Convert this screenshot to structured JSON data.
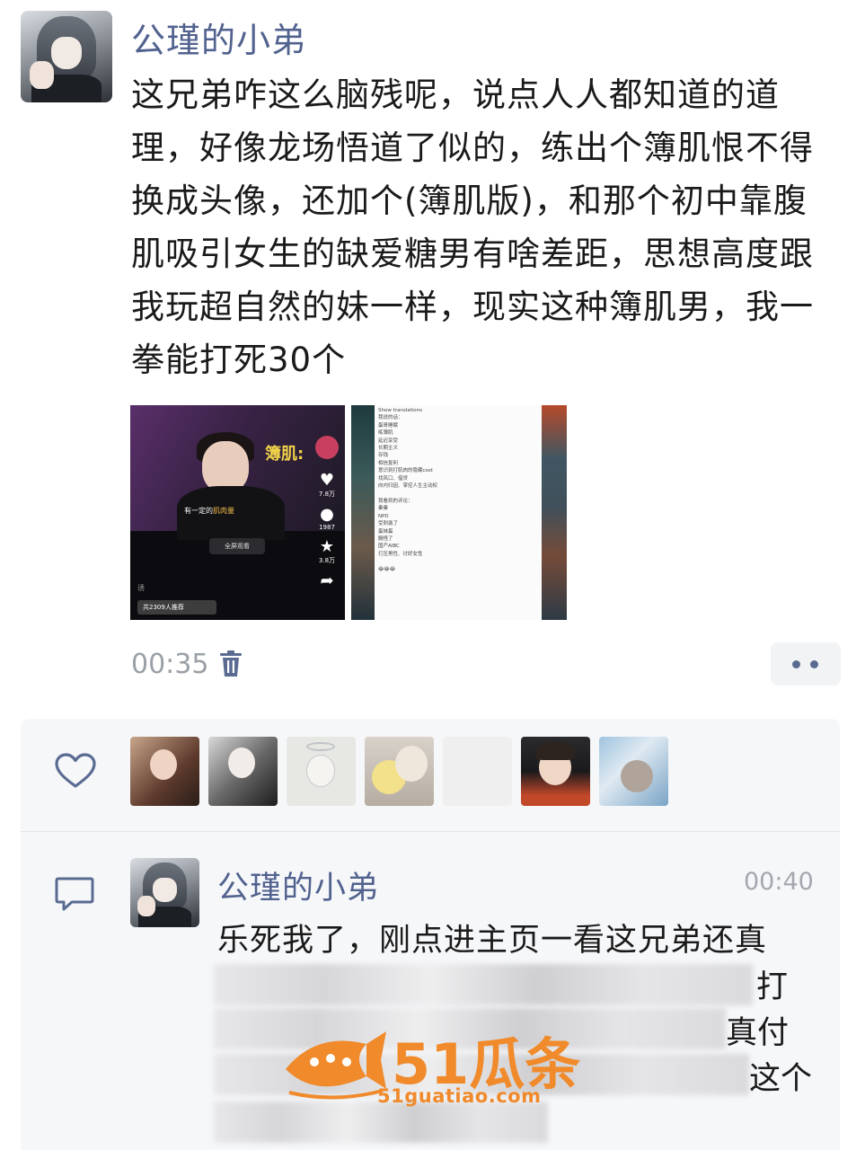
{
  "post": {
    "author": "公瑾的小弟",
    "text": "这兄弟咋这么脑残呢，说点人人都知道的道理，好像龙场悟道了似的，练出个簿肌恨不得换成头像，还加个(簿肌版)，和那个初中靠腹肌吸引女生的缺爱糖男有啥差距，思想高度跟我玩超自然的妹一样，现实这种簿肌男，我一拳能打死30个",
    "time": "00:35"
  },
  "thumb_video": {
    "tag": "簿肌:",
    "subtitle_prefix": "有一定的",
    "subtitle_highlight": "肌肉量",
    "fullscreen": "全屏观看",
    "likes": "7.8万",
    "comments": "1987",
    "favorites": "3.8万",
    "recommend": "共2309人推荐",
    "mark": "诱"
  },
  "thumb_doc": {
    "text": "Show translations\n我说的话：\n蛋哥睡眠\n练薄肌\n延迟享受\n长期主义\n存钱\n相信复利\n意识到打肌肉的隐藏cost\n找风口、借贷\n向内归因、掌控人生主动权\n\n我看到的评论：\n秦秦\nNPD\n受刺激了\n蛋妹蛋\n膈怪了\n国产AIBC\n打压男性、讨好女性\n\n😂😂😂"
  },
  "comment": {
    "author": "公瑾的小弟",
    "time": "00:40",
    "line1": "乐死我了，刚点进主页一看这兄弟还真",
    "tail2": "打",
    "tail3": "真付",
    "tail4": "这个"
  },
  "watermark": {
    "brand": "51瓜条",
    "url": "51guatiao.com"
  },
  "colors": {
    "name_blue": "#52628f",
    "watermark_orange": "#f08a2b",
    "panel_bg": "#f6f7f9"
  }
}
